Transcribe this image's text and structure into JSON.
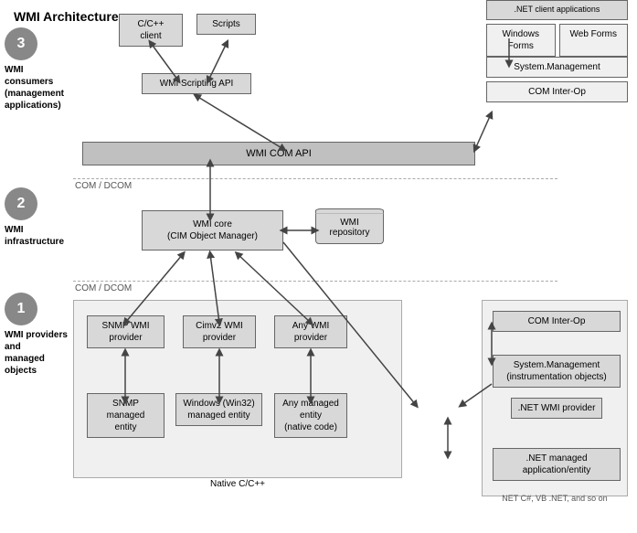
{
  "title": "WMI Architecture",
  "layer3": {
    "number": "3",
    "label": "WMI consumers\n(management\napplications)"
  },
  "layer2": {
    "number": "2",
    "label": "WMI infrastructure"
  },
  "layer1": {
    "number": "1",
    "label": "WMI providers\nand\nmanaged\nobjects"
  },
  "dotnet_top": {
    "header": ".NET client applications",
    "windows_forms": "Windows Forms",
    "web_forms": "Web Forms"
  },
  "boxes": {
    "cc_client": "C/C++\nclient",
    "scripts": "Scripts",
    "scripting_api": "WMI Scripting API",
    "com_api": "WMI COM API",
    "system_management_top": "System.Management",
    "com_interop_top": "COM Inter-Op",
    "wmi_core": "WMI core\n(CIM Object Manager)",
    "wmi_repository": "WMI\nrepository",
    "snmp_provider": "SNMP WMI\nprovider",
    "cimv2_provider": "Cimv2 WMI\nprovider",
    "any_provider": "Any WMI\nprovider",
    "snmp_managed": "SNMP\nmanaged\nentity",
    "win32_managed": "Windows (Win32)\nmanaged entity",
    "any_managed": "Any managed\nentity\n(native code)",
    "native_label": "Native C/C++",
    "com_interop_r": "COM Inter-Op",
    "sysmgmt_r": "System.Management\n(instrumentation objects)",
    "dotnet_wmi_provider": ".NET WMI provider",
    "dotnet_managed": ".NET managed\napplication/entity",
    "dotnet_bottom": "NET C#, VB .NET, and so on"
  },
  "comdcom": "COM / DCOM"
}
